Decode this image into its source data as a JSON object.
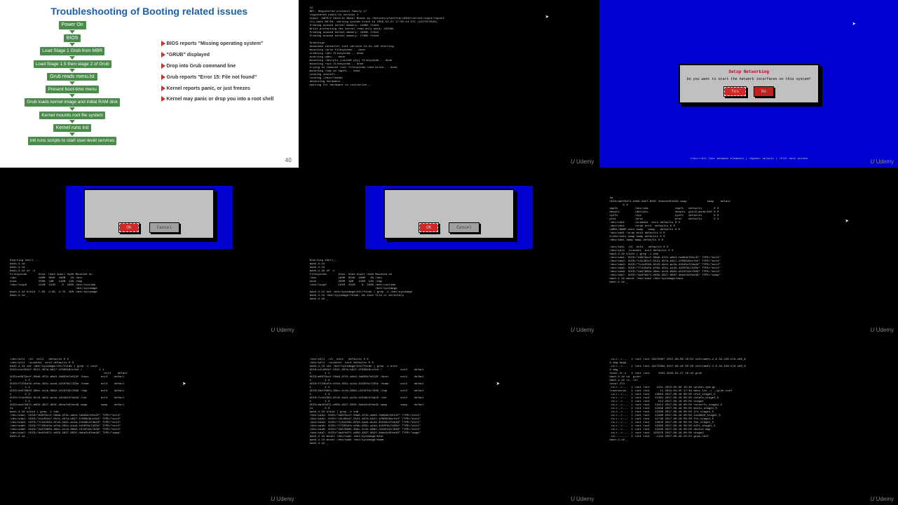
{
  "udemy": "Udemy",
  "slide": {
    "title": "Troubleshooting of Booting related issues",
    "left_steps": [
      "Power On",
      "BIOS",
      "Load Stage 1 Grub\nfrom MBR",
      "Load Stage 1.5 then\nstage 2 of Grub",
      "Grub reads menu.lst",
      "Present boot-time menu",
      "Grub loads kernel image\nand initial RAM disk",
      "Kernel mounts root\nfile system",
      "Kernel runs init",
      "init runs scripts to start\nuser-level services"
    ],
    "right_events": [
      "BIOS reports\n\"Missing operating system\"",
      "\"GRUB\" displayed",
      "Drop into Grub\ncommand line",
      "Grub reports\n\"Error 15: File not found\"",
      "Kernel reports panic,\nor just freezes",
      "Kernel may panic or drop\nyou into a root shell"
    ],
    "pagenum": "40"
  },
  "cell2": {
    "text": "12\nNET: Registered protocol family 17\nregistered tasks:ts version 1\ninput: ImPS/2 Generic Wheel Mouse as /devices/platform/i8042/serio1/input/input3\nrtc_cmos 00:04: setting system clock to 2018-01-27 17:02:14 UTC (1517072534)\nFreeing unused kernel memory: 1296k freed\nWrite protecting the kernel read-only data: 10240k\nFreeing unused kernel memory: 1800k freed\nFreeing unused kernel memory: 1760k freed\n\nGreetings.\nanaconda installer init version 13.21.149 starting\nmounting /proc filesystem... done\ncreating /dev filesystem... done\nstarting udev... done\nmounting /dev/pts (unix98 pty) filesystem... done\nmounting /sys filesystem... done\ntrying to remount root filesystem read write... done\nmounting /tmp as tmpfs... done\nrunning install...\nrunning /sbin/loader\ndetecting hardware...\nwaiting for hardware to initialize..."
  },
  "cell3": {
    "dialog_title": "Setup Networking",
    "dialog_msg": "Do you want to start the network\ninterfaces on this system?",
    "btn_yes": "Yes",
    "btn_no": "No",
    "helpbar": "<Tab>/<Alt-Tab> between elements   |   <Space> selects   |   <F12> next screen"
  },
  "cell45": {
    "term_pre": "Starting shell...\nbash-4.1#\nbash-4.1#\nbash-4.1# df -h\nFilesystem       Size  Used Avail Use% Mounted on\n/dev             180M  304K  180M   1% /dev\nnone             250M  19M   118M  14% /tmp\n/dev/loop0       131M  131M    0  100% /mnt/runtime\n                                       /mnt/sysimage\nbash-4.1# blkid  7.9G  2.9G  4.7G  39% /mnt/sysimage\nbash-4.1# _",
    "term_post": "Starting shell...\nbash-4.1#\nbash-4.1#\nbash-4.1# df -h\nFilesystem       Size  Used Avail Use% Mounted on\n/dev             180M  304K  180M   1% /dev\nnone             250M  19M   118M  14% /tmp\n/dev/loop0       131M  131M    0  100% /mnt/runtime\n                                       /mnt/sysimage\nbash-4.1# cat /mnt/sysimage/etc/fstab | grep -i /mnt/sysimage\nbash-4.1# /mnt/sysimage/fstab: No such file or directory\nbash-4.1# _",
    "btn_ok": "OK",
    "btn_cancel": "Cancel"
  },
  "cell6": {
    "text": "tm    -                                                   \nUUID=da4fb971-e656-4627-803f 4ebe2c6fee49 swap            swap    defaul\n        0 0\ntmpfs          /dev/shm                tmpfs   defaults       0 0\ndevpts         /dev/pts                devpts  gid=5,mode=620 0 0\nsysfs          /sys                    sysfs   defaults       0 0\nproc           /proc                   proc    defaults       0 0\n/dev/sdb1      /oradata  ext4 defaults 0 0\n/dev/sdc1      /orad ext4  defaults 0 0\nLABEL=SWAP:sdc1 swap   swap   defaults 0 0\n/dev/sdd1 /orae ext4 defaults 0 0\n#/dev/sde1 swap swap defaults 0 0\n/dev/sde1 swap swap defaults 0 0\n\n/dev/sd11  /dl  ext4   defaults 0 0\n/dev/sdl2  /orashk1  ext4 defaults 0 0\nbash-4.1# blkid | grep -i sda\n/dev/sda1: UUID=\"e9879ccf-56a8-4f31-a0e3-fa893e7e513f\" TYPE=\"ext4\"\n/dev/sda2: UUID=\"c2c301e7-5521-407a-b917-1f80618ccfe4\" TYPE=\"ext4\"\n/dev/sda3: UUID=\"7c1e2584-8fd3-4a41-ac2a-41046c37da16\" TYPE=\"ext4\"\n/dev/sda5: UUID=\"f7235dfe-efbb-455c-a1dd-4150f9c7425e\" TYPE=\"ext4\"\n/dev/sda6: UUID=\"2a578804-39ec-4c1b-9682-c523f42c7839\" TYPE=\"ext4\"\n/dev/sda7: UUID=\"da4fb971-e656-4627-803f-4ebe2c6fee49\" TYPE=\"swap\"\nbash-4.1# mount /dev/sda1 /mnt/sysimage/boot\nbash-4.1# _"
  },
  "cell7": {
    "text": "/dev/sdl1  /dl  ext4   defaults 0 0\n/dev/sdl2  /orashk1  ext4 defaults 0 0\nbash-4.1# cat /mnt/sysimage/etc/fstab | grep -i uuid\nUUID=c2c301e7-5521-407a-b917-1f80618ccfe4 /          1 1\n                                                        ext4    defaul\nUUID=e9879ccf-56a8-4f31-a0e3-fa893e7e513f /boot       ext4    defaul\nt        1 2\nUUID=f7235dfe-efbb-455c-a1dd-4150f9c7425e /home       ext4    defaul\nt        1 2\nUUID=2a578804-39ec-4c1b-9682-c523f42c7839 /tmp        ext4    defaul\nt        1 2\nUUID=7c1e2584-8fd3-4a41-ac2a-41046c37da16 /var        ext4    defaul\nt        1 2\nUUID=da4fb971-e656-4627-803f-4ebe2c6fee49 swap        swap    defaul\nts       0 0\nbash-4.1# blkid | grep -i sda\n/dev/sda1: UUID=\"e9879ccf-56a8-4f31-a0e3-fa893e7e513f\" TYPE=\"ext4\"\n/dev/sda2: UUID=\"c2c301e7-5521-407a-b917-1f80618ccfe4\" TYPE=\"ext4\"\n/dev/sda3: UUID=\"7c1e2584-8fd3-4a41-ac2a-41046c37da16\" TYPE=\"ext4\"\n/dev/sda5: UUID=\"f7235dfe-efbb-455c-a1dd-4150f9c7425e\" TYPE=\"ext4\"\n/dev/sda6: UUID=\"2a578804-39ec-4c1b-9682-c523f42c7839\" TYPE=\"ext4\"\n/dev/sda7: UUID=\"da4fb971-e656-4627-803f-4ebe2c6fee49\" TYPE=\"swap\"\nbash-4.1# _"
  },
  "cell8": {
    "text": "/dev/sdl1  /dl  ext4   defaults 0 0\n/dev/sdl2  /orashk1  ext4 defaults 0 0\nbash-4.1# cat /mnt/sysimage/etc/fstab | grep -i uuid\nUUID=c2c301e7-5521-407a-b917-1f80618ccfe4 /           ext4    defaul\nt        1 1\nUUID=e9879ccf-56a8-4f31-a0e3-fa893e7e513f /boot       ext4    defaul\nt        1 2\nUUID=f7235dfe-efbb-455c-a1dd-4150f9c7425e /home       ext4    defaul\nt        1 2\nUUID=2a578804-39ec-4c1b-9682-c523f42c7839 /tmp        ext4    defaul\nt        1 2\nUUID=7c1e2584-8fd3-4a41-ac2a-41046c37da16 /var        ext4    defaul\nt        1 2\nUUID=da4fb971-e656-4627-803f-4ebe2c6fee49 swap        swap    defaul\nts       0 0\nbash-4.1# blkid | grep -i sda\n/dev/sda1: UUID=\"e9879ccf-56a8-4f31-a0e3-fa893e7e513f\" TYPE=\"ext4\"\n/dev/sda2: UUID=\"c2c301e7-5521-407a-b917-1f80618ccfe4\" TYPE=\"ext4\"\n/dev/sda3: UUID=\"7c1e2584-8fd3-4a41-ac2a-41046c37da16\" TYPE=\"ext4\"\n/dev/sda5: UUID=\"f7235dfe-efbb-455c-a1dd-4150f9c7425e\" TYPE=\"ext4\"\n/dev/sda6: UUID=\"2a578804-39ec-4c1b-9682-c523f42c7839\" TYPE=\"ext4\"\n/dev/sda7: UUID=\"da4fb971-e656-4627-803f-4ebe2c6fee49\" TYPE=\"swap\"\nbash-4.1# mount /dev/sda1 /mnt/sysimage/boot\nbash-4.1# mount /dev/sda5 /mnt/sysimage/home\nbash-4.1# _"
  },
  "cell9": {
    "text": "-rw-r--r--.  1 root root 16170407 2017-08-08 16:01 initramfs-2.6.32-220.el6.x86_6\n4.img.bkpp\n-rw-r--r--.  1 root root 16170384 2017-08-16 02:56 initramfs-2.6.32-220.el6.x86_6\n4.img\ndrwxr-xr-x.  2 root root     1024 2018-01-27 16:42 grub\nbash-4.1# cd  grub/\nbash-4.1# ls -ltr\ntotal 274\n-rw-r--r--.  1 root root    1341 2010-05-06 10:38 splash.xpm.gz\nlrwxrwxrwx.  1 root root      11 2013-04-25 17:48 menu.lst -> ./grub.conf\n-rw-r--r--.  1 root root   13964 2017-08-18 00:50 ufs2_stage1_5\n-rw-r--r--.  1 root root   11364 2017-08-18 00:50 vstafs_stage1_5\n-rw-r--r--.  1 root root     512 2017-08-18 00:50 stage1\n-rw-r--r--.  1 root root   14412 2017-08-18 00:50 reiserfs_stage1_5\n-rw-r--r--.  1 root root   11956 2017-08-18 00:50 minix_stage1_5\n-rw-r--r--.  1 root root   13268 2017-08-18 00:50 jfs_stage1_5\n-rw-r--r--.  1 root root   13380 2017-08-18 00:50 iso9660_stage1_5\n-rw-r--r--.  1 root root   11748 2017-08-18 00:50 ffs_stage1_5\n-rw-r--r--.  1 root root   12620 2017-08-18 00:50 fat_stage1_5\n-rw-r--r--.  1 root root   13380 2017-08-18 00:50 e2fs_stage1_5\n-rw-r--r--.  1 root root   13260 2017-08-18 00:50 device.map\n-rw-r--r--.  1 root root  125976 2017-08-18 00:50 stage2\n-rw-------.  1 root root    1144 2017-08-29 23:54 grub.conf\nbash-4.1# _"
  }
}
